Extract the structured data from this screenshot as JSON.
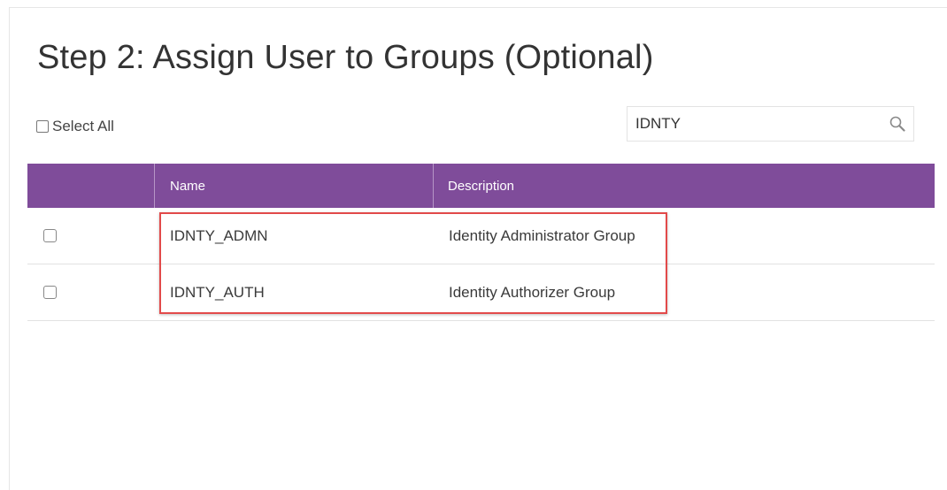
{
  "page": {
    "title": "Step 2: Assign User to Groups (Optional)"
  },
  "select_all": {
    "label": "Select All",
    "checked": false
  },
  "search": {
    "value": "IDNTY",
    "icon": "search-icon"
  },
  "table": {
    "columns": [
      "",
      "Name",
      "Description"
    ],
    "rows": [
      {
        "name": "IDNTY_ADMN",
        "description": "Identity Administrator Group",
        "checked": false
      },
      {
        "name": "IDNTY_AUTH",
        "description": "Identity Authorizer Group",
        "checked": false
      }
    ]
  },
  "colors": {
    "header_bg": "#7f4c9a",
    "highlight_border": "#e24a4a"
  }
}
